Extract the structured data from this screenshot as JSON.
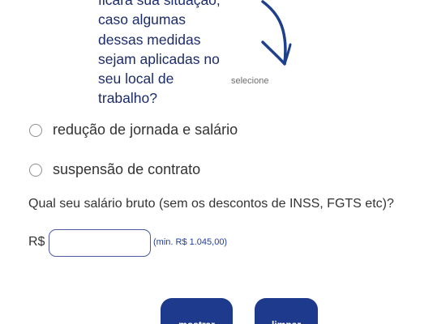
{
  "question": {
    "lines": [
      "ficará sua situação,",
      "caso algumas",
      "dessas medidas",
      "sejam aplicadas no",
      "seu local de",
      "trabalho?"
    ],
    "select_hint": "selecione"
  },
  "options": [
    "redução de jornada e salário",
    "suspensão de contrato"
  ],
  "salary": {
    "question": "Qual seu salário bruto (sem os descontos de INSS, FGTS etc)?",
    "currency": "R$",
    "value": "",
    "min_hint": "(min. R$ 1.045,00)"
  },
  "buttons": {
    "show": "mostrar",
    "clear": "limpar"
  },
  "colors": {
    "question_text": "#1c2c6b",
    "accent": "#1e3a8c",
    "input_border": "#4a5aa5",
    "hint": "#1f3f9e"
  },
  "icons": {
    "arrow": "curved-arrow-down-icon"
  }
}
